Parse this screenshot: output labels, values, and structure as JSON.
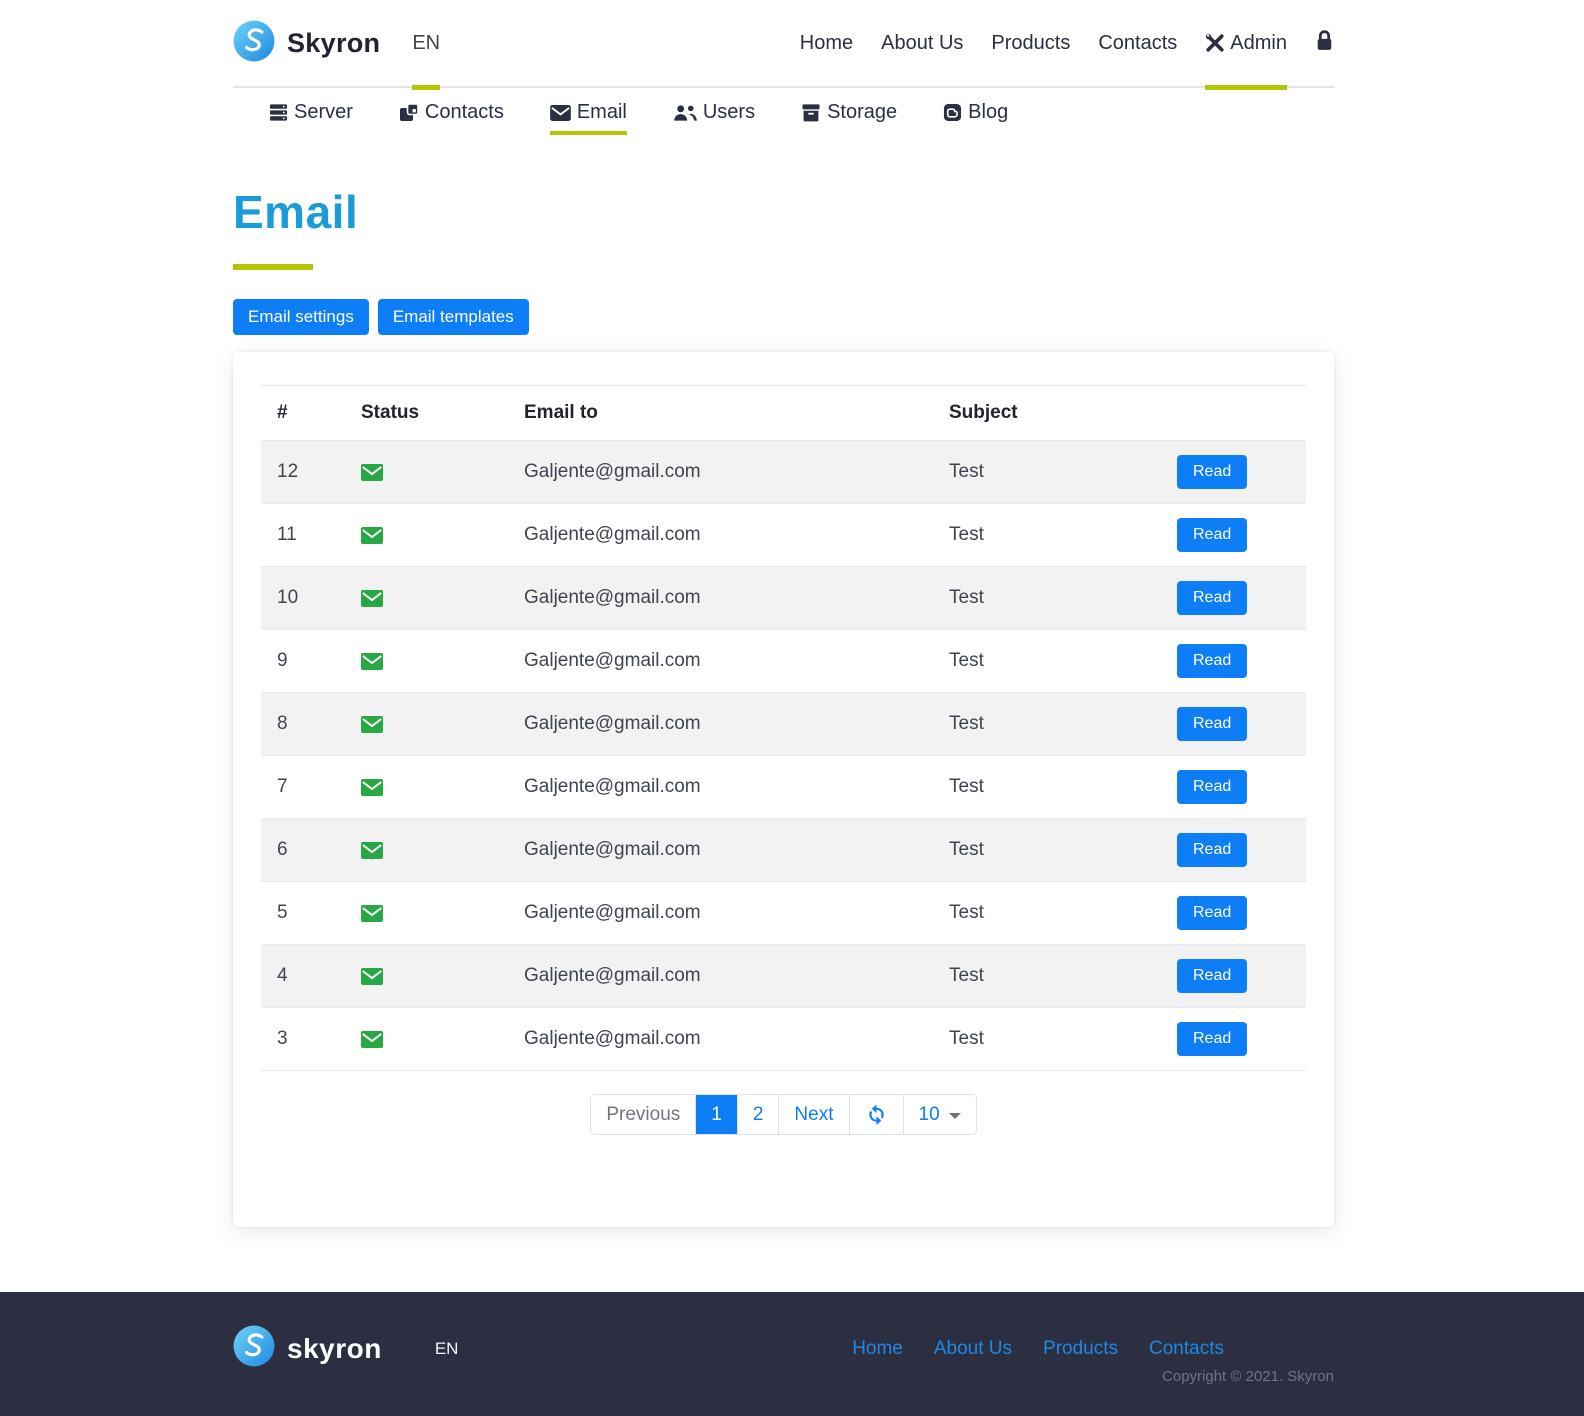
{
  "brand": {
    "name": "Skyron",
    "footer_name": "skyron"
  },
  "header": {
    "language": "EN",
    "nav": {
      "home": "Home",
      "about": "About Us",
      "products": "Products",
      "contacts": "Contacts",
      "admin": "Admin"
    }
  },
  "subnav": {
    "server": "Server",
    "contacts": "Contacts",
    "email": "Email",
    "users": "Users",
    "storage": "Storage",
    "blog": "Blog"
  },
  "page": {
    "title": "Email"
  },
  "actions": {
    "settings": "Email settings",
    "templates": "Email templates"
  },
  "table": {
    "columns": {
      "id": "#",
      "status": "Status",
      "email_to": "Email to",
      "subject": "Subject"
    },
    "read_label": "Read",
    "rows": [
      {
        "id": "12",
        "status": "sent",
        "email_to": "Galjente@gmail.com",
        "subject": "Test"
      },
      {
        "id": "11",
        "status": "sent",
        "email_to": "Galjente@gmail.com",
        "subject": "Test"
      },
      {
        "id": "10",
        "status": "sent",
        "email_to": "Galjente@gmail.com",
        "subject": "Test"
      },
      {
        "id": "9",
        "status": "sent",
        "email_to": "Galjente@gmail.com",
        "subject": "Test"
      },
      {
        "id": "8",
        "status": "sent",
        "email_to": "Galjente@gmail.com",
        "subject": "Test"
      },
      {
        "id": "7",
        "status": "sent",
        "email_to": "Galjente@gmail.com",
        "subject": "Test"
      },
      {
        "id": "6",
        "status": "sent",
        "email_to": "Galjente@gmail.com",
        "subject": "Test"
      },
      {
        "id": "5",
        "status": "sent",
        "email_to": "Galjente@gmail.com",
        "subject": "Test"
      },
      {
        "id": "4",
        "status": "sent",
        "email_to": "Galjente@gmail.com",
        "subject": "Test"
      },
      {
        "id": "3",
        "status": "sent",
        "email_to": "Galjente@gmail.com",
        "subject": "Test"
      }
    ]
  },
  "pagination": {
    "previous": "Previous",
    "pages": [
      "1",
      "2"
    ],
    "active_page": "1",
    "next": "Next",
    "page_size": "10"
  },
  "footer": {
    "language": "EN",
    "links": [
      "Home",
      "About Us",
      "Products",
      "Contacts"
    ],
    "copyright": "Copyright © 2021. Skyron"
  },
  "colors": {
    "accent_green": "#b2c700",
    "heading_blue": "#1b9bd7",
    "primary_blue": "#0d7ef5",
    "status_green": "#28a745",
    "footer_bg": "#2b2f41",
    "footer_link_blue": "#1e88e5",
    "stripe_gray": "#f2f2f2",
    "dark_navy": "#2b2f42"
  }
}
